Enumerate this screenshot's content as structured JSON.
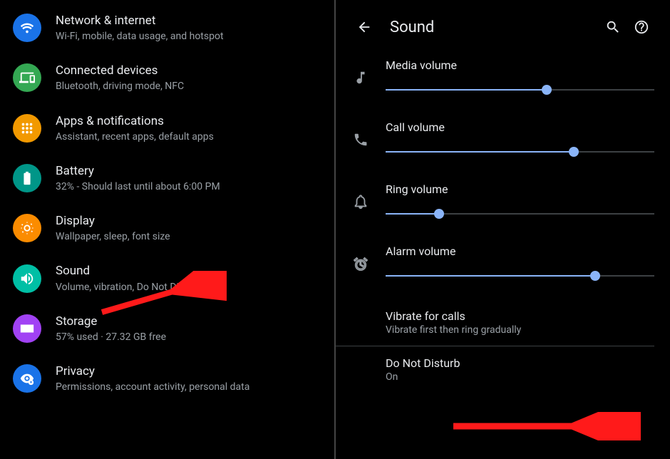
{
  "settings": [
    {
      "key": "network",
      "title": "Network & internet",
      "sub": "Wi-Fi, mobile, data usage, and hotspot",
      "colorClass": "ic-blue"
    },
    {
      "key": "devices",
      "title": "Connected devices",
      "sub": "Bluetooth, driving mode, NFC",
      "colorClass": "ic-green"
    },
    {
      "key": "apps",
      "title": "Apps & notifications",
      "sub": "Assistant, recent apps, default apps",
      "colorClass": "ic-orange"
    },
    {
      "key": "battery",
      "title": "Battery",
      "sub": "32% - Should last until about 6:00 PM",
      "colorClass": "ic-teal"
    },
    {
      "key": "display",
      "title": "Display",
      "sub": "Wallpaper, sleep, font size",
      "colorClass": "ic-orange2"
    },
    {
      "key": "sound",
      "title": "Sound",
      "sub": "Volume, vibration, Do Not Disturb",
      "colorClass": "ic-teal2"
    },
    {
      "key": "storage",
      "title": "Storage",
      "sub": "57% used · 27.32 GB free",
      "colorClass": "ic-purple"
    },
    {
      "key": "privacy",
      "title": "Privacy",
      "sub": "Permissions, account activity, personal data",
      "colorClass": "ic-blue2"
    }
  ],
  "sound": {
    "header": "Sound",
    "sliders": [
      {
        "key": "media",
        "label": "Media volume",
        "value": 60
      },
      {
        "key": "call",
        "label": "Call volume",
        "value": 70
      },
      {
        "key": "ring",
        "label": "Ring volume",
        "value": 20
      },
      {
        "key": "alarm",
        "label": "Alarm volume",
        "value": 78
      }
    ],
    "vibrate": {
      "title": "Vibrate for calls",
      "sub": "Vibrate first then ring gradually"
    },
    "dnd": {
      "title": "Do Not Disturb",
      "sub": "On"
    }
  }
}
